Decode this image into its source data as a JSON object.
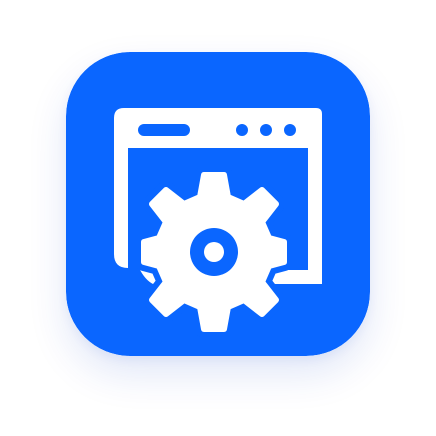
{
  "icon": {
    "name": "browser-settings-app-icon",
    "symbol": "window-with-gear-icon",
    "colors": {
      "tile": "#0a66ff",
      "glyph": "#ffffff"
    }
  }
}
